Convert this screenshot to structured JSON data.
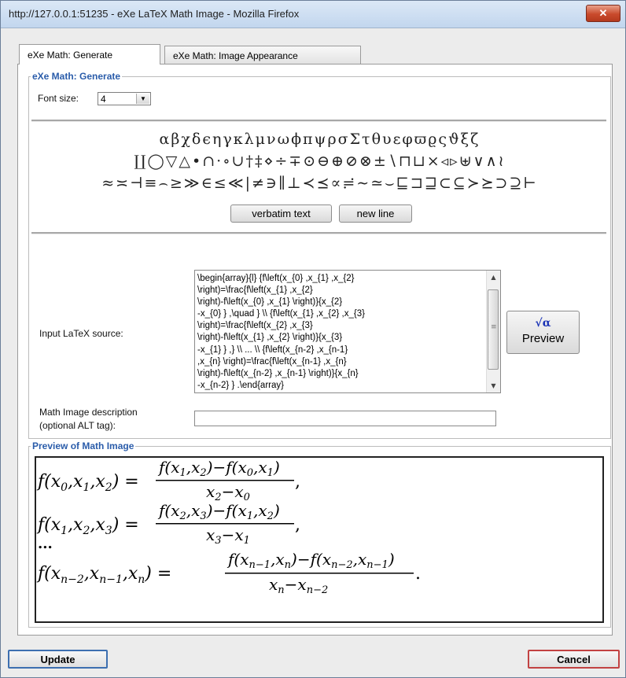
{
  "window": {
    "title": "http://127.0.0.1:51235 - eXe LaTeX Math Image - Mozilla Firefox",
    "close_glyph": "✕"
  },
  "tabs": [
    {
      "label": "eXe Math: Generate",
      "active": true
    },
    {
      "label": "eXe Math: Image Appearance",
      "active": false
    }
  ],
  "generate": {
    "legend": "eXe Math: Generate",
    "font_size_label": "Font size:",
    "font_size_value": "4",
    "symbols_row1": [
      "α",
      "β",
      "χ",
      "δ",
      "ϵ",
      "η",
      "γ",
      "κ",
      "λ",
      "μ",
      "ν",
      "ω",
      "ϕ",
      "π",
      "ψ",
      "ρ",
      "σ",
      "Σ",
      "τ",
      "θ",
      "υ",
      "ε",
      "φ",
      "ϖ",
      "ϱ",
      "ς",
      "ϑ",
      "ξ",
      "ζ"
    ],
    "symbols_row2": [
      "∐",
      "◯",
      "▽",
      "△",
      "•",
      "∩",
      "·",
      "∘",
      "∪",
      "†",
      "‡",
      "⋄",
      "÷",
      "∓",
      "⊙",
      "⊖",
      "⊕",
      "⊘",
      "⊗",
      "±",
      "∖",
      "⊓",
      "⊔",
      "×",
      "◃",
      "▹",
      "⊎",
      "∨",
      "∧",
      "≀"
    ],
    "symbols_row3": [
      "≈",
      "≍",
      "⊣",
      "≡",
      "⌢",
      "≥",
      "≫",
      "∈",
      "≤",
      "≪",
      "|",
      "≠",
      "∋",
      "∥",
      "⊥",
      "≺",
      "⪯",
      "∝",
      "≓",
      "∼",
      "≃",
      "⌣",
      "⊑",
      "⊐",
      "⊒",
      "⊂",
      "⊆",
      "≻",
      "⪰",
      "⊃",
      "⊇",
      "⊢"
    ],
    "verbatim_button": "verbatim text",
    "newline_button": "new line",
    "input_label": "Input LaTeX source:",
    "latex_source": "\\begin{array}{l} {f\\left(x_{0} ,x_{1} ,x_{2}\n\\right)=\\frac{f\\left(x_{1} ,x_{2}\n\\right)-f\\left(x_{0} ,x_{1} \\right)}{x_{2}\n-x_{0} } ,\\quad } \\\\ {f\\left(x_{1} ,x_{2} ,x_{3}\n\\right)=\\frac{f\\left(x_{2} ,x_{3}\n\\right)-f\\left(x_{1} ,x_{2} \\right)}{x_{3}\n-x_{1} } ,} \\\\ ... \\\\ {f\\left(x_{n-2} ,x_{n-1}\n,x_{n} \\right)=\\frac{f\\left(x_{n-1} ,x_{n}\n\\right)-f\\left(x_{n-2} ,x_{n-1} \\right)}{x_{n}\n-x_{n-2} } .\\end{array}",
    "preview_button_icon": "√α",
    "preview_button_label": "Preview",
    "alt_label_line1": "Math Image description",
    "alt_label_line2": "(optional ALT tag):",
    "alt_value": ""
  },
  "preview": {
    "legend": "Preview of Math Image",
    "ellipsis": "..."
  },
  "footer": {
    "update_button": "Update",
    "cancel_button": "Cancel"
  }
}
